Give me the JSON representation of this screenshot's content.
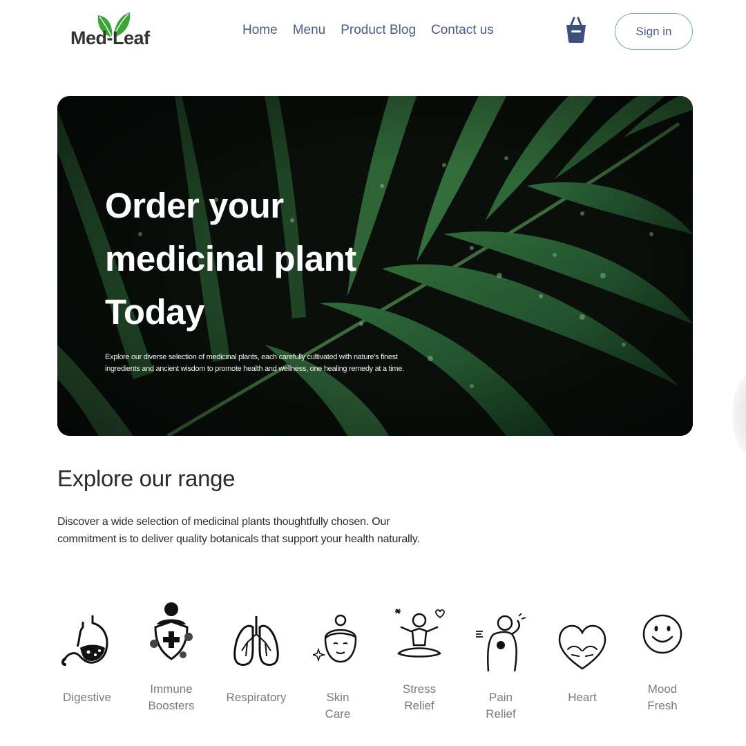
{
  "brand": {
    "name": "Med-Leaf",
    "leaf_color": "#3aa635"
  },
  "nav": [
    {
      "label": "Home"
    },
    {
      "label": "Menu"
    },
    {
      "label": "Product Blog"
    },
    {
      "label": "Contact us"
    }
  ],
  "header": {
    "cart_icon": "shopping-basket-icon",
    "signin_label": "Sign in"
  },
  "hero": {
    "title_lines": [
      "Order your",
      "medicinal plant",
      "Today"
    ],
    "description": "Explore our diverse selection of medicinal plants, each carefully cultivated with nature's finest ingredients and ancient wisdom to promote health and wellness, one healing remedy at a time."
  },
  "range": {
    "title": "Explore our range",
    "description": "Discover a wide selection of medicinal plants thoughtfully chosen. Our commitment is to deliver quality botanicals that support your health naturally."
  },
  "categories": [
    {
      "label": "Digestive",
      "icon": "stomach-icon"
    },
    {
      "label": "Immune Boosters",
      "icon": "immune-shield-icon"
    },
    {
      "label": "Respiratory",
      "icon": "lungs-icon"
    },
    {
      "label": "Skin Care",
      "icon": "face-skin-icon"
    },
    {
      "label": "Stress Relief",
      "icon": "meditation-icon"
    },
    {
      "label": "Pain Relief",
      "icon": "back-pain-icon"
    },
    {
      "label": "Heart",
      "icon": "heart-hands-icon"
    },
    {
      "label": "Mood Fresh",
      "icon": "smiley-icon"
    }
  ]
}
